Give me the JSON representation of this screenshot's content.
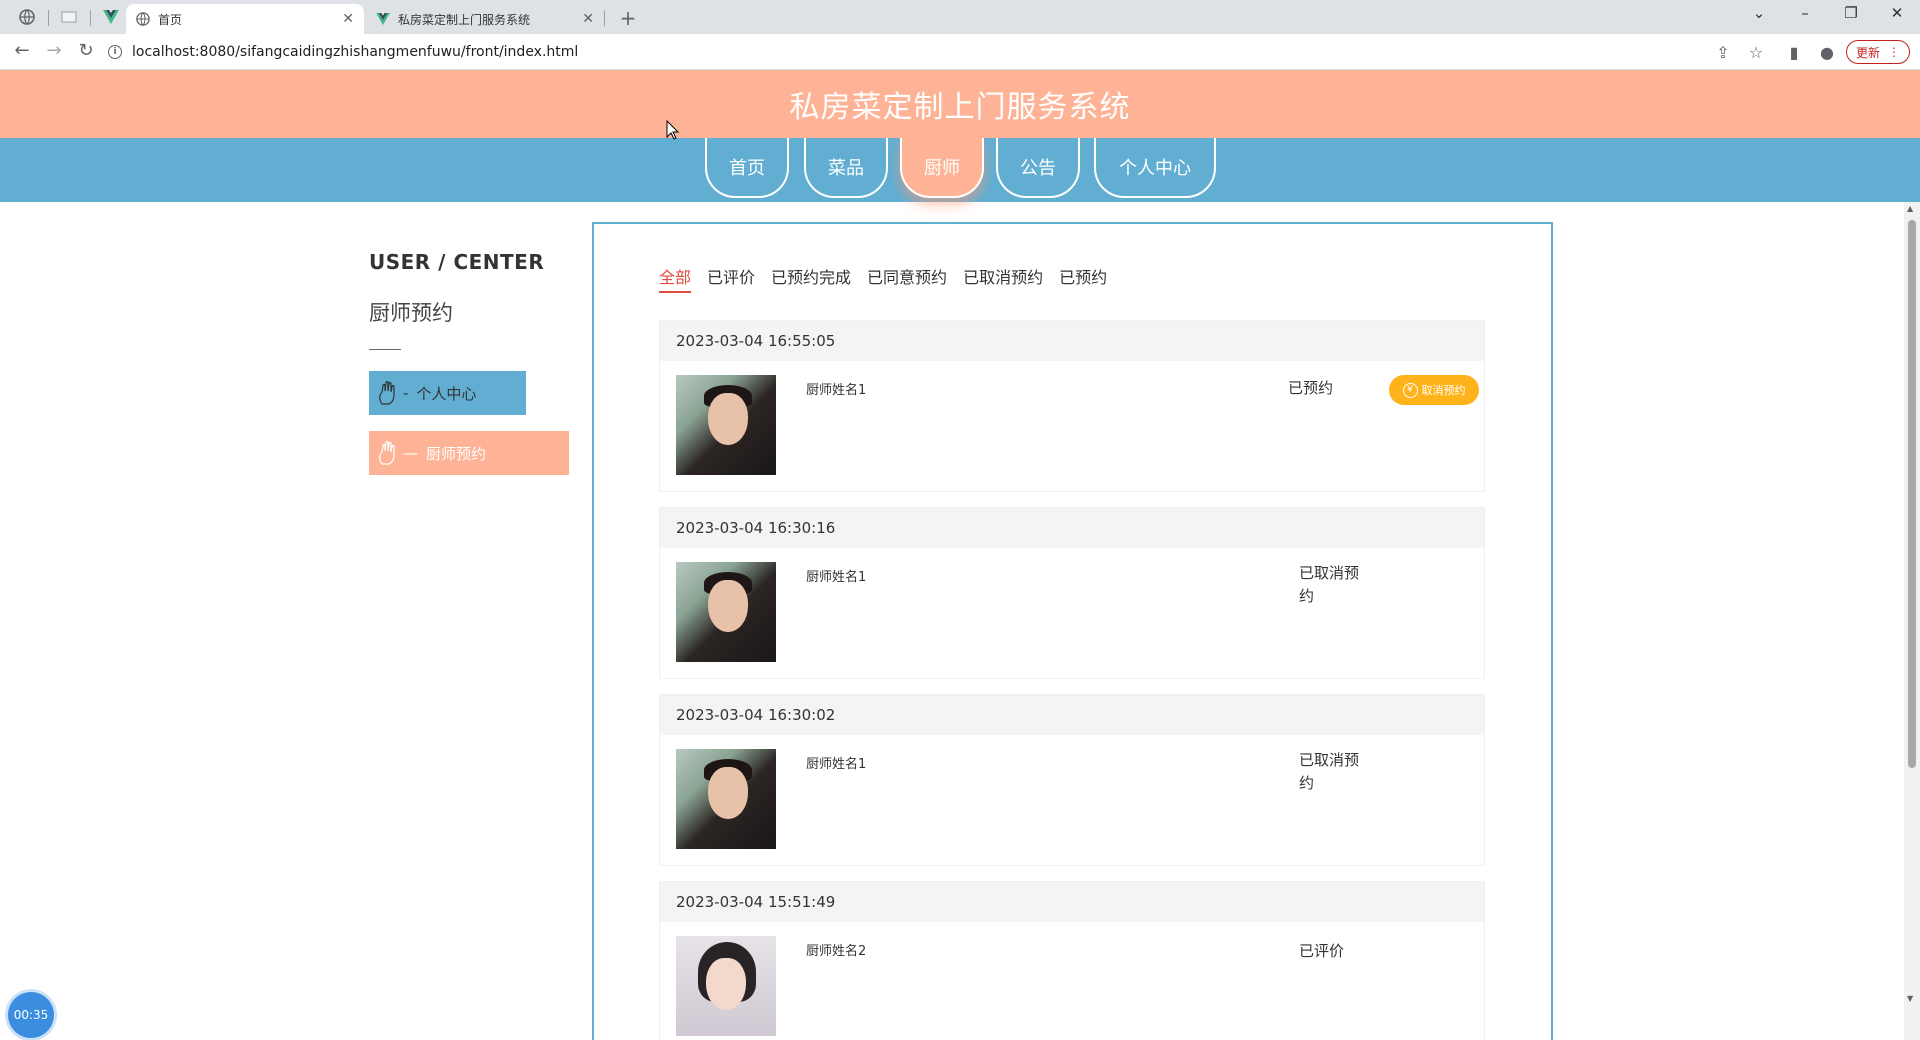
{
  "browser": {
    "tabs": [
      {
        "label": "首页",
        "icon": "globe-icon"
      },
      {
        "label": "私房菜定制上门服务系统",
        "icon": "vue-logo-icon"
      }
    ],
    "url": "localhost:8080/sifangcaidingzhishangmenfuwu/front/index.html",
    "update_label": "更新"
  },
  "site": {
    "title": "私房菜定制上门服务系统",
    "nav": [
      {
        "label": "首页"
      },
      {
        "label": "菜品"
      },
      {
        "label": "厨师"
      },
      {
        "label": "公告"
      },
      {
        "label": "个人中心"
      }
    ],
    "active_nav": "厨师"
  },
  "sidebar": {
    "title": "USER / CENTER",
    "subtitle": "厨师预约",
    "items": [
      {
        "label": "个人中心",
        "prefix": "-"
      },
      {
        "label": "厨师预约",
        "prefix": "—"
      }
    ]
  },
  "filters": [
    "全部",
    "已评价",
    "已预约完成",
    "已同意预约",
    "已取消预约",
    "已预约"
  ],
  "active_filter": "全部",
  "orders": [
    {
      "datetime": "2023-03-04 16:55:05",
      "chef": "厨师姓名1",
      "status": "已预约",
      "action": "取消预约"
    },
    {
      "datetime": "2023-03-04 16:30:16",
      "chef": "厨师姓名1",
      "status": "已取消预约",
      "action": ""
    },
    {
      "datetime": "2023-03-04 16:30:02",
      "chef": "厨师姓名1",
      "status": "已取消预约",
      "action": ""
    },
    {
      "datetime": "2023-03-04 15:51:49",
      "chef": "厨师姓名2",
      "status": "已评价",
      "action": ""
    }
  ],
  "timer": "00:35",
  "colors": {
    "header": "#ffb396",
    "nav": "#62aed3",
    "accent_red": "#e14a3f",
    "button_yellow": "#ffb31a"
  }
}
